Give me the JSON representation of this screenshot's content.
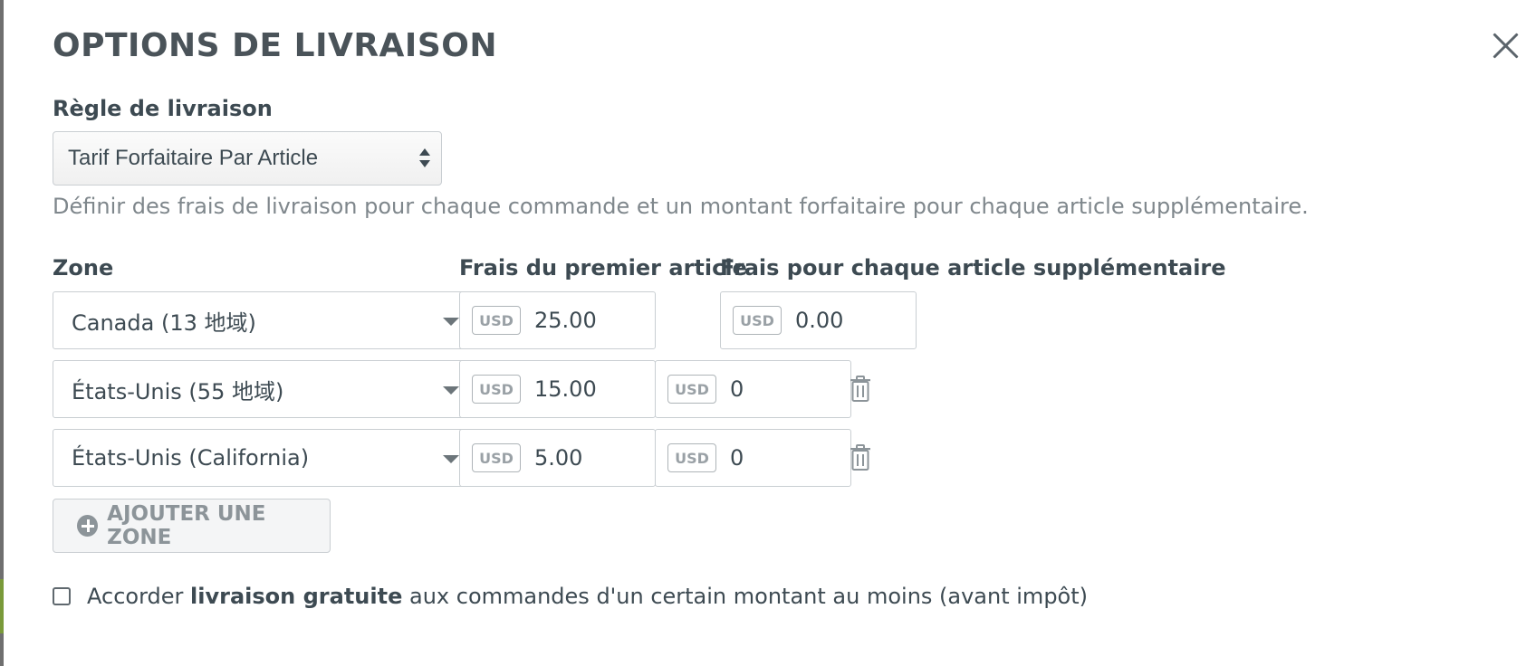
{
  "modal": {
    "title": "OPTIONS DE LIVRAISON",
    "close_icon": "close-icon"
  },
  "shipping_rule": {
    "label": "Règle de livraison",
    "selected": "Tarif Forfaitaire Par Article",
    "help_text": "Définir des frais de livraison pour chaque commande et un montant forfaitaire pour chaque article supplémentaire."
  },
  "columns": {
    "zone": "Zone",
    "first_item": "Frais du premier article",
    "additional_item": "Frais pour chaque article supplémentaire"
  },
  "rows": [
    {
      "zone": "Canada (13 地域)",
      "currency": "USD",
      "first_fee": "25.00",
      "additional_fee": "0.00",
      "deletable": false
    },
    {
      "zone": "États-Unis (55 地域)",
      "currency": "USD",
      "first_fee": "15.00",
      "additional_fee": "0",
      "deletable": true
    },
    {
      "zone": "États-Unis (California)",
      "currency": "USD",
      "first_fee": "5.00",
      "additional_fee": "0",
      "deletable": true
    }
  ],
  "add_zone": {
    "label": "AJOUTER UNE ZONE",
    "icon": "plus-circle-icon"
  },
  "free_shipping": {
    "checked": false,
    "text_before": "Accorder",
    "text_bold": "livraison gratuite",
    "text_after": "aux commandes d'un certain montant au moins (avant impôt)"
  },
  "colors": {
    "text": "#3d4a52",
    "muted": "#7f878c",
    "border": "#c9ced2"
  }
}
